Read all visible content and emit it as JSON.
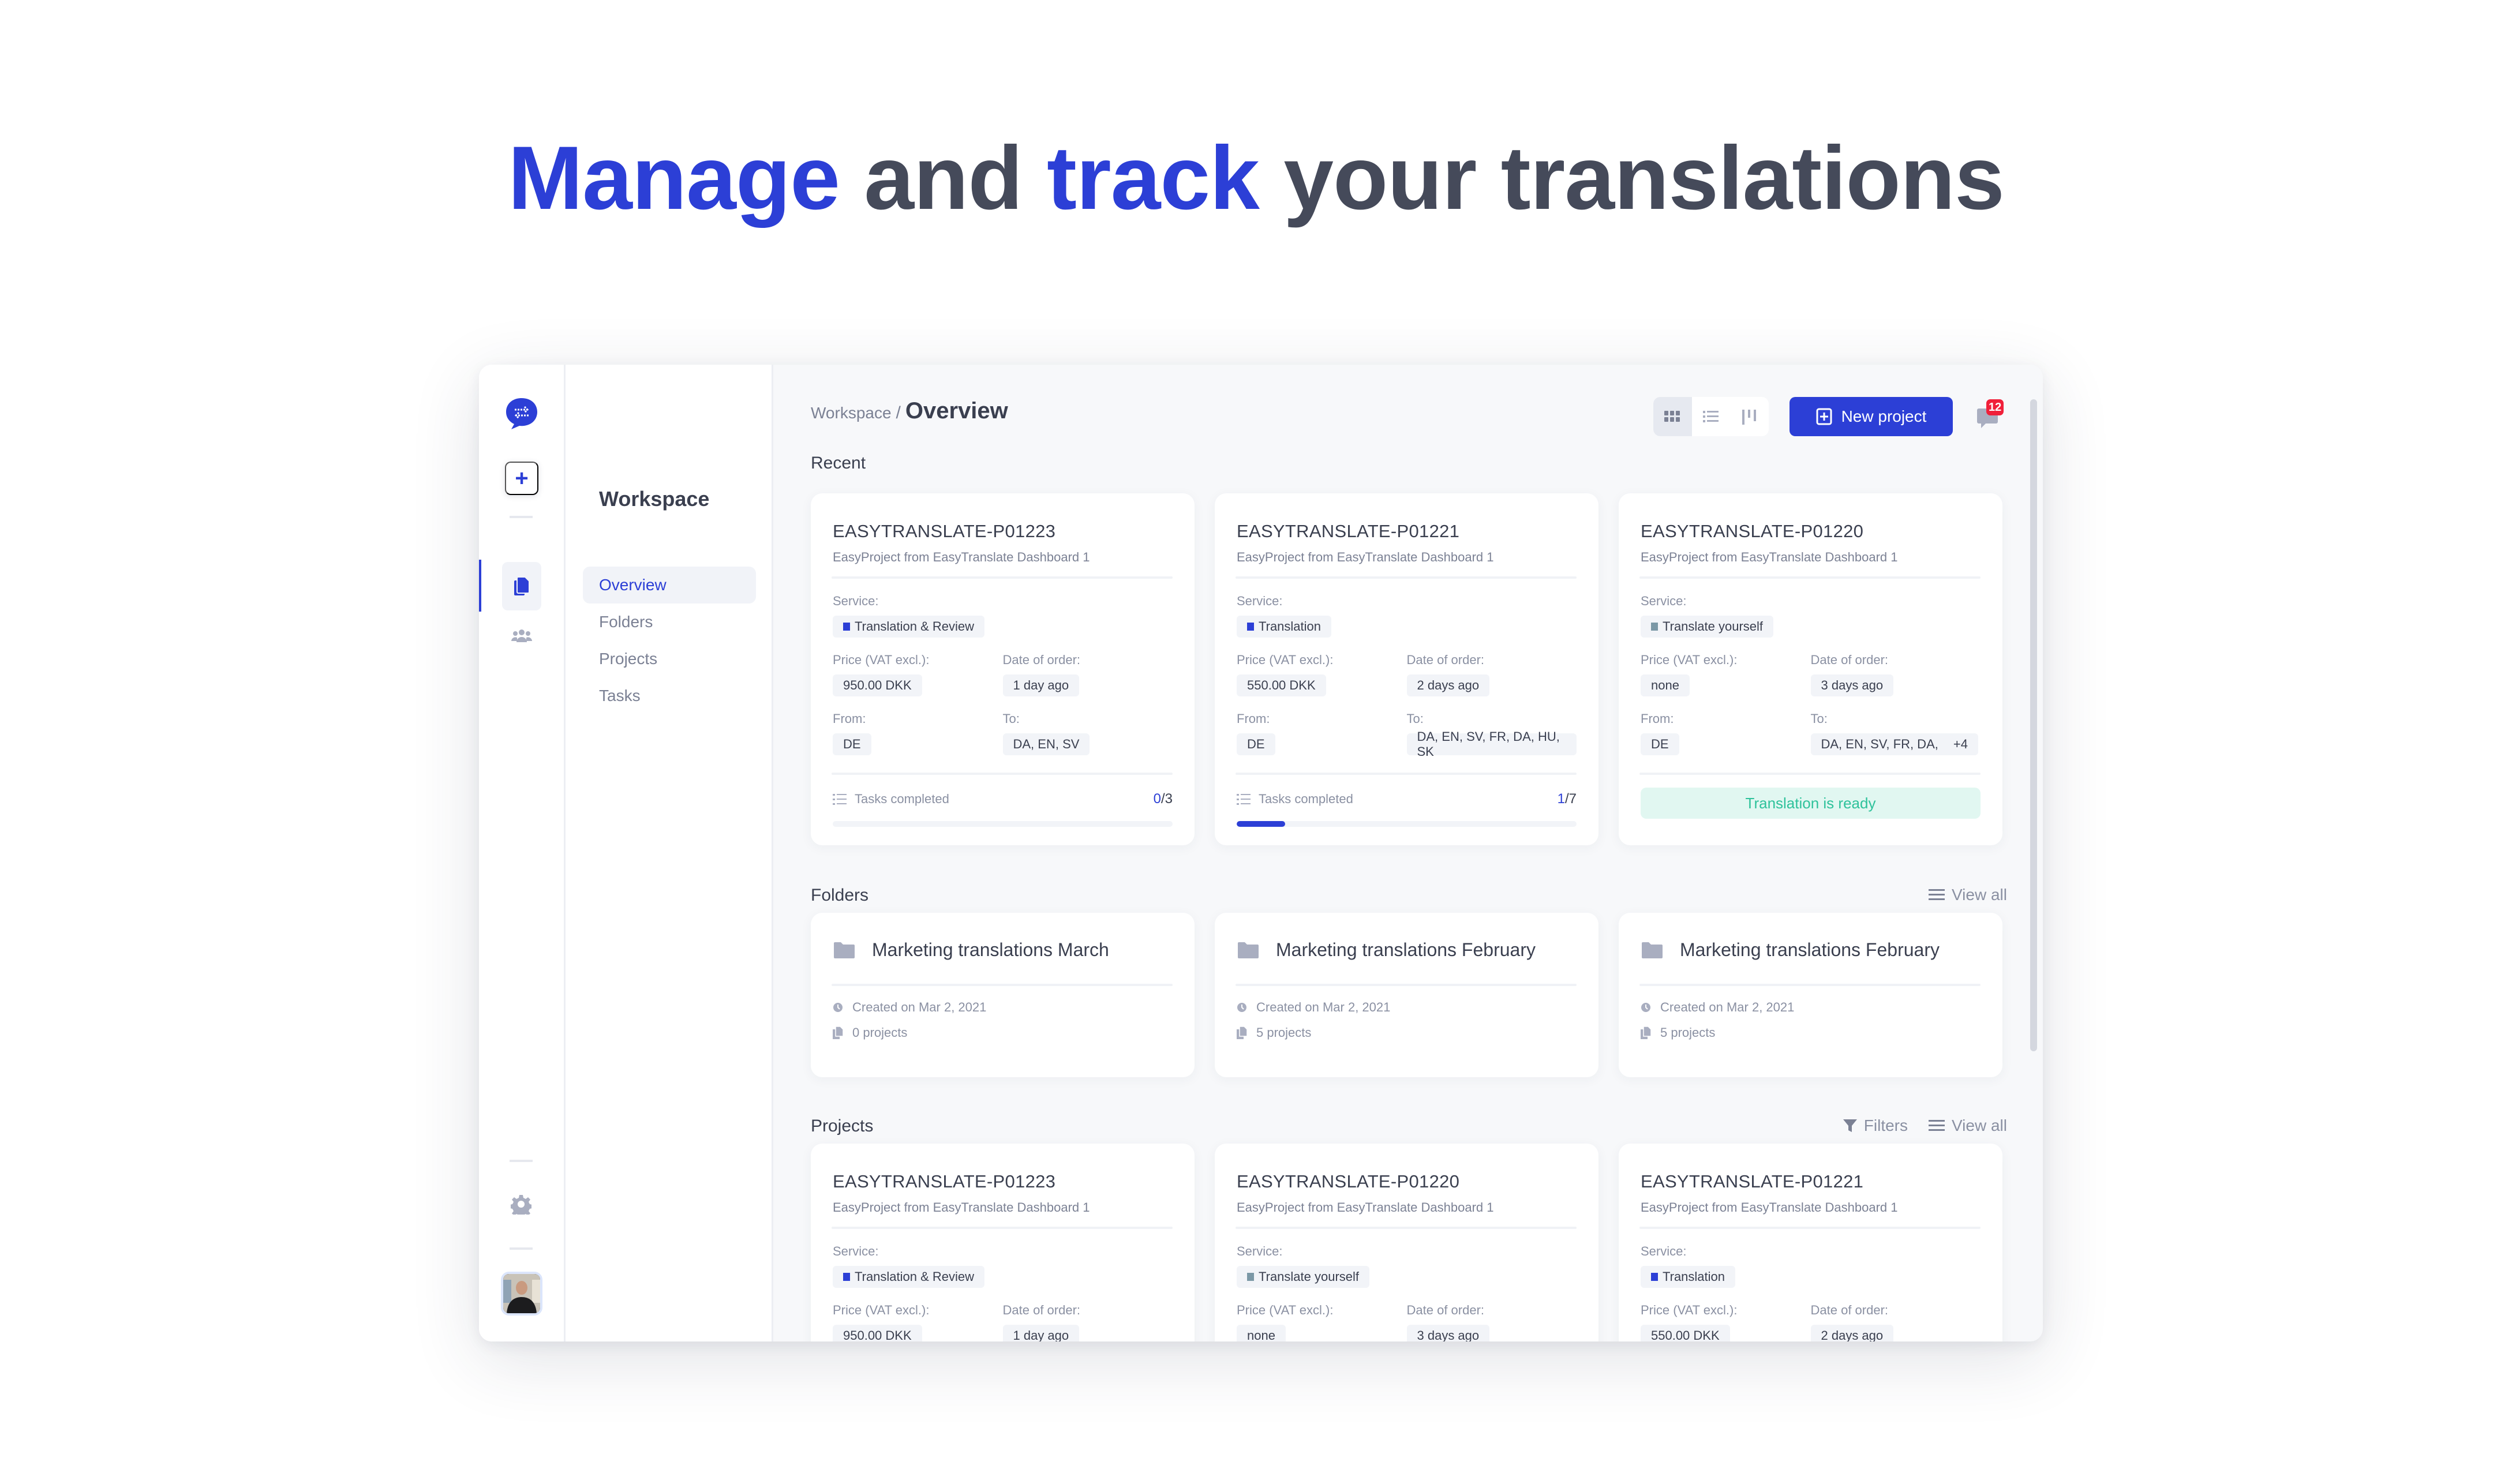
{
  "headline": {
    "parts": [
      {
        "text": "Manage",
        "accent": true
      },
      {
        "text": " and ",
        "accent": false
      },
      {
        "text": "track",
        "accent": true
      },
      {
        "text": " your translations",
        "accent": false
      }
    ]
  },
  "colors": {
    "accent": "#2c3fd6",
    "text_dark": "#3a3f4f",
    "text_muted": "#7b8194",
    "badge_red": "#f0203a",
    "ready_green": "#2ec29b",
    "ready_bg": "#e1f7f1",
    "service_translate_yourself": "#7b98a6"
  },
  "rail": {
    "icons": [
      "logo-icon",
      "add-icon",
      "documents-icon",
      "team-icon",
      "gear-icon",
      "avatar"
    ]
  },
  "nav": {
    "title": "Workspace",
    "items": [
      {
        "label": "Overview",
        "active": true
      },
      {
        "label": "Folders",
        "active": false
      },
      {
        "label": "Projects",
        "active": false
      },
      {
        "label": "Tasks",
        "active": false
      }
    ]
  },
  "header": {
    "breadcrumb_parent": "Workspace",
    "breadcrumb_sep": "/",
    "breadcrumb_current": "Overview",
    "view_modes": [
      "grid",
      "list",
      "board"
    ],
    "active_view": "grid",
    "new_project_label": "New project",
    "notifications_count": "12"
  },
  "labels": {
    "service": "Service:",
    "price": "Price (VAT excl.):",
    "date": "Date of order:",
    "from": "From:",
    "to": "To:",
    "tasks_completed": "Tasks completed"
  },
  "recent": {
    "title": "Recent",
    "cards": [
      {
        "id": "EASYTRANSLATE-P01223",
        "subtitle": "EasyProject from EasyTranslate Dashboard 1",
        "service": "Translation & Review",
        "service_color": "#2c3fd6",
        "price": "950.00 DKK",
        "date": "1 day ago",
        "from": "DE",
        "to": "DA, EN, SV",
        "tasks_done": "0",
        "tasks_total": "3",
        "progress": 0.0
      },
      {
        "id": "EASYTRANSLATE-P01221",
        "subtitle": "EasyProject from EasyTranslate Dashboard 1",
        "service": "Translation",
        "service_color": "#2c3fd6",
        "price": "550.00 DKK",
        "date": "2 days ago",
        "from": "DE",
        "to": "DA, EN, SV, FR, DA, HU, SK",
        "tasks_done": "1",
        "tasks_total": "7",
        "progress": 0.143
      },
      {
        "id": "EASYTRANSLATE-P01220",
        "subtitle": "EasyProject from EasyTranslate Dashboard 1",
        "service": "Translate yourself",
        "service_color": "#7b98a6",
        "price": "none",
        "date": "3 days ago",
        "from": "DE",
        "to": "DA, EN, SV, FR, DA,",
        "to_more": "+4",
        "status": "Translation is ready"
      }
    ]
  },
  "folders": {
    "title": "Folders",
    "view_all": "View all",
    "cards": [
      {
        "name": "Marketing translations March",
        "created": "Created on Mar 2, 2021",
        "projects": "0 projects"
      },
      {
        "name": "Marketing translations February",
        "created": "Created on Mar 2, 2021",
        "projects": "5 projects"
      },
      {
        "name": "Marketing translations February",
        "created": "Created on Mar 2, 2021",
        "projects": "5 projects"
      }
    ]
  },
  "projects": {
    "title": "Projects",
    "filters": "Filters",
    "view_all": "View all",
    "cards": [
      {
        "id": "EASYTRANSLATE-P01223",
        "subtitle": "EasyProject from EasyTranslate Dashboard 1",
        "service": "Translation & Review",
        "service_color": "#2c3fd6",
        "price": "950.00 DKK",
        "date": "1 day ago"
      },
      {
        "id": "EASYTRANSLATE-P01220",
        "subtitle": "EasyProject from EasyTranslate Dashboard 1",
        "service": "Translate yourself",
        "service_color": "#7b98a6",
        "price": "none",
        "date": "3 days ago"
      },
      {
        "id": "EASYTRANSLATE-P01221",
        "subtitle": "EasyProject from EasyTranslate Dashboard 1",
        "service": "Translation",
        "service_color": "#2c3fd6",
        "price": "550.00 DKK",
        "date": "2 days ago"
      }
    ]
  }
}
